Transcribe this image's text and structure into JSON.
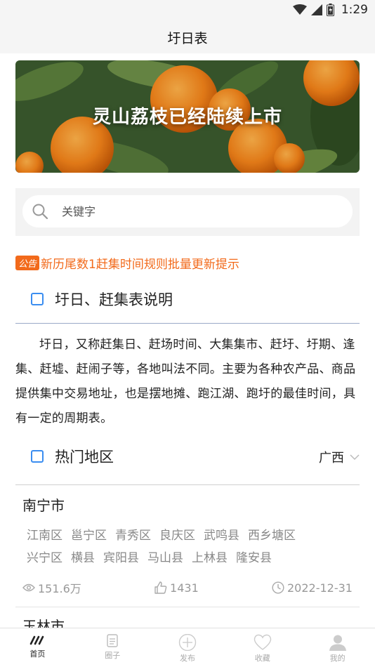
{
  "status_bar": {
    "time": "1:29"
  },
  "header": {
    "title": "圩日表"
  },
  "banner": {
    "caption": "灵山荔枝已经陆续上市"
  },
  "search": {
    "placeholder": "关键字"
  },
  "notice": {
    "tag": "公告",
    "text": "新历尾数1赶集时间规则批量更新提示"
  },
  "intro": {
    "heading": "圩日、赶集表说明",
    "body": "圩日，又称赶集日、赶场时间、大集集市、赶圩、圩期、逢集、赶墟、赶闹子等，各地叫法不同。主要为各种农产品、商品提供集中交易地址，也是摆地摊、跑江湖、跑圩的最佳时间，具有一定的周期表。"
  },
  "hot_regions": {
    "heading": "热门地区",
    "selected_province": "广西",
    "cities": [
      {
        "name": "南宁市",
        "districts": [
          "江南区",
          "邕宁区",
          "青秀区",
          "良庆区",
          "武鸣县",
          "西乡塘区",
          "兴宁区",
          "横县",
          "宾阳县",
          "马山县",
          "上林县",
          "隆安县"
        ],
        "views": "151.6万",
        "likes": "1431",
        "date": "2022-12-31"
      },
      {
        "name": "玉林市"
      }
    ]
  },
  "tabbar": {
    "items": [
      {
        "label": "首页",
        "icon": "home-icon",
        "active": true
      },
      {
        "label": "圈子",
        "icon": "circle-doc-icon",
        "active": false
      },
      {
        "label": "发布",
        "icon": "plus-circle-icon",
        "active": false
      },
      {
        "label": "收藏",
        "icon": "heart-icon",
        "active": false
      },
      {
        "label": "我的",
        "icon": "user-icon",
        "active": false
      }
    ]
  },
  "colors": {
    "accent": "#3a8df0",
    "notice": "#f26a1b",
    "muted": "#888888"
  }
}
